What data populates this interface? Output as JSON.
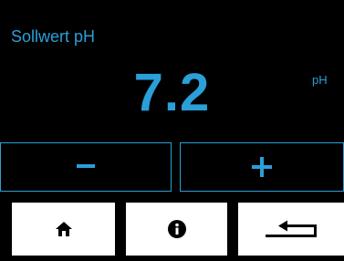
{
  "screen": {
    "title": "Sollwert pH",
    "value": "7.2",
    "unit": "pH"
  },
  "controls": {
    "decrease_icon": "minus-icon",
    "increase_icon": "plus-icon"
  },
  "nav": {
    "home_icon": "home-icon",
    "info_icon": "info-icon",
    "back_icon": "return-arrow-icon"
  },
  "colors": {
    "accent": "#2a9fd8",
    "background": "#000000",
    "nav_button": "#ffffff"
  }
}
